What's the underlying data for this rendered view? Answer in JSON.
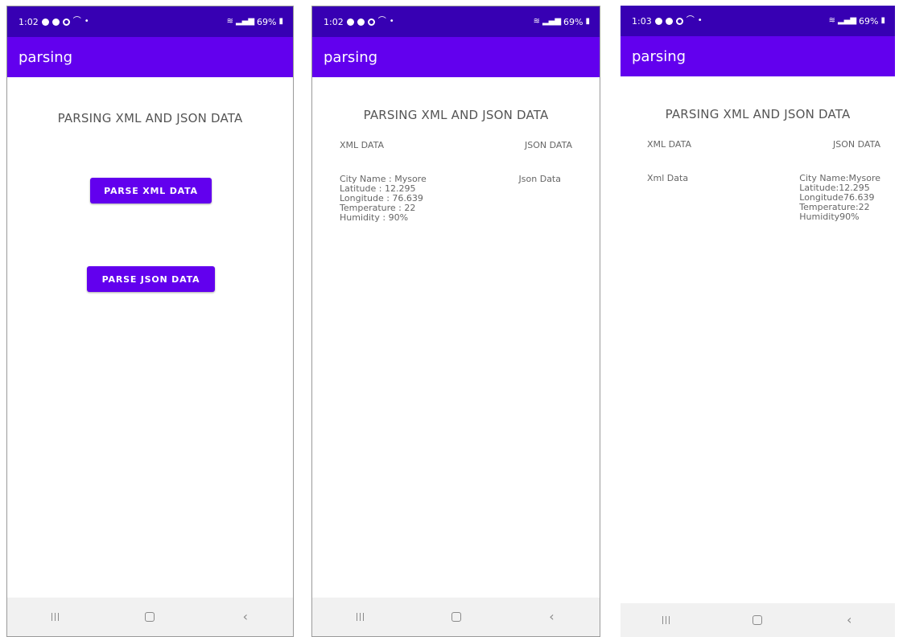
{
  "colors": {
    "primary": "#6200ee",
    "primary_dark": "#3700b3",
    "text_secondary": "#666666",
    "nav_bar_bg": "#f1f1f1"
  },
  "screens": [
    {
      "status": {
        "time": "1:02",
        "battery": "69%"
      },
      "app_title": "parsing",
      "heading": "PARSING XML AND JSON DATA",
      "buttons": {
        "xml": "PARSE XML DATA",
        "json": "PARSE JSON DATA"
      }
    },
    {
      "status": {
        "time": "1:02",
        "battery": "69%"
      },
      "app_title": "parsing",
      "heading": "PARSING XML AND JSON DATA",
      "xml_header": "XML DATA",
      "json_header": "JSON DATA",
      "xml_lines": [
        "City Name : Mysore",
        "Latitude : 12.295",
        "Longitude : 76.639",
        "Temperature : 22",
        "Humidity : 90%"
      ],
      "json_lines": [
        "Json Data"
      ]
    },
    {
      "status": {
        "time": "1:03",
        "battery": "69%"
      },
      "app_title": "parsing",
      "heading": "PARSING XML AND JSON DATA",
      "xml_header": "XML DATA",
      "json_header": "JSON DATA",
      "xml_lines": [
        "Xml Data"
      ],
      "json_lines": [
        "City Name:Mysore",
        "Latitude:12.295",
        "Longitude76.639",
        "Temperature:22",
        "Humidity90%"
      ]
    }
  ]
}
